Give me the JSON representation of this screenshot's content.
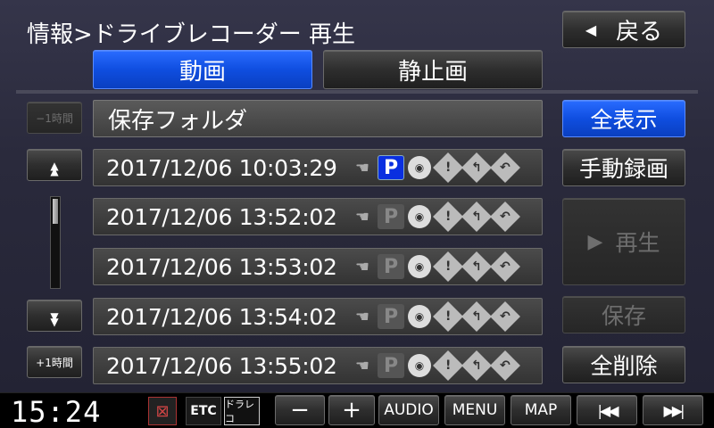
{
  "header": {
    "breadcrumb": "情報>ドライブレコーダー 再生",
    "back_label": "戻る",
    "back_icon": "◀"
  },
  "tabs": [
    {
      "label": "動画",
      "active": true
    },
    {
      "label": "静止画",
      "active": false
    }
  ],
  "left_controls": {
    "minus_hour": "−1時間",
    "up_icon": "▲▲",
    "down_icon": "▼▼",
    "plus_hour": "+1時間"
  },
  "folder": {
    "label": "保存フォルダ"
  },
  "recordings": [
    {
      "timestamp": "2017/12/06  10:03:29",
      "parking": true
    },
    {
      "timestamp": "2017/12/06  13:52:02",
      "parking": false
    },
    {
      "timestamp": "2017/12/06  13:53:02",
      "parking": false
    },
    {
      "timestamp": "2017/12/06  13:54:02",
      "parking": false
    },
    {
      "timestamp": "2017/12/06  13:55:02",
      "parking": false
    }
  ],
  "icons": {
    "parking": "P",
    "alert": "!"
  },
  "side": {
    "show_all": "全表示",
    "manual_record": "手動録画",
    "play": "再生",
    "play_icon": "▶",
    "save": "保存",
    "delete_all": "全削除"
  },
  "bottom": {
    "clock": "15:24",
    "etc": "ETC",
    "dashcam": "ドラレコ",
    "minus": "−",
    "plus": "+",
    "audio": "AUDIO",
    "menu": "MENU",
    "map": "MAP",
    "prev_icon": "|◀◀",
    "next_icon": "▶▶|"
  },
  "colors": {
    "accent_blue": "#0f4ee0",
    "parking_active": "#0a2fe0"
  }
}
